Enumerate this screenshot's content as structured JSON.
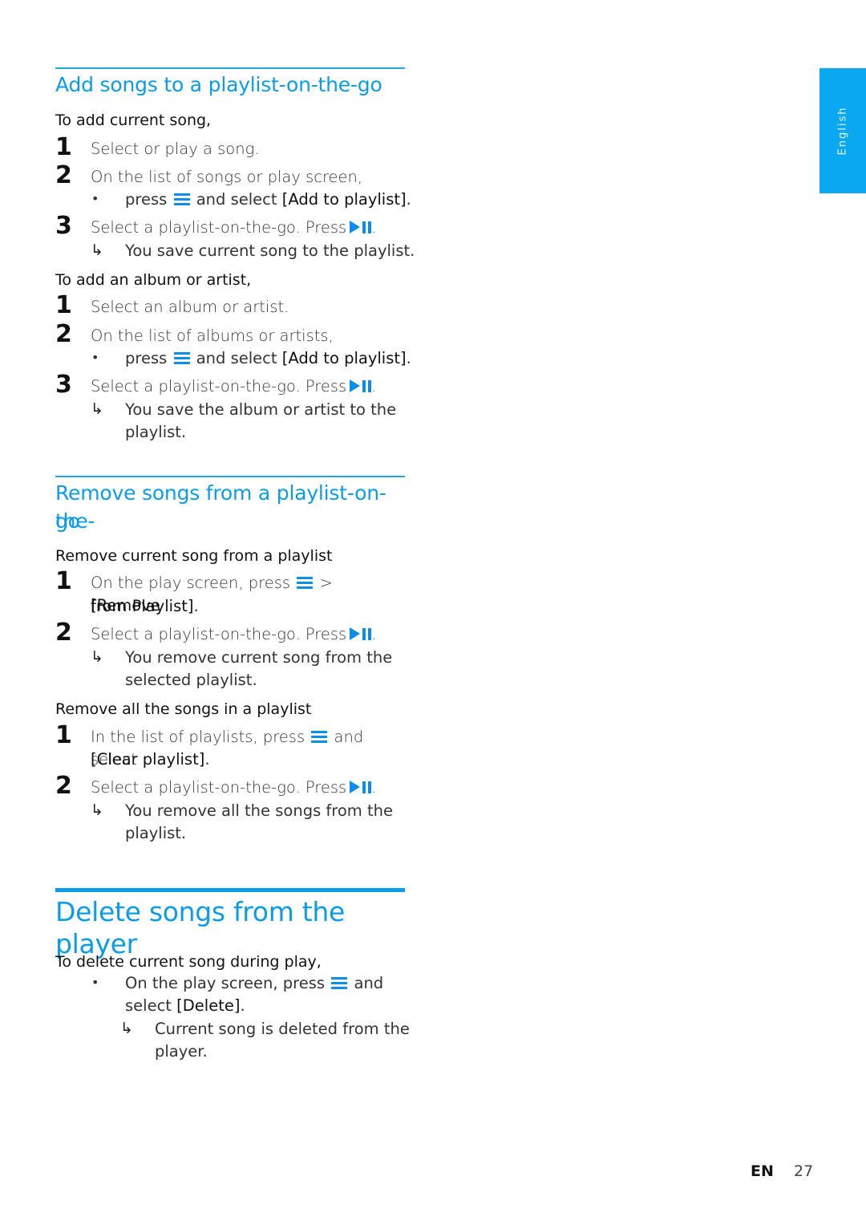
{
  "side_tab": {
    "label": "English",
    "color": "#0aa8ee"
  },
  "accent_color": "#0a9ce8",
  "section_add": {
    "title": "Add songs to a playlist-on-the-go",
    "current_song": {
      "heading": "To add current song,",
      "steps": [
        {
          "num": "1",
          "text": "Select or play a song."
        },
        {
          "num": "2",
          "text": "On the list of songs or play screen,",
          "bullet_pre": "press",
          "bullet_mid": "and select",
          "bullet_bold": "[Add to playlist]",
          "bullet_end": "."
        },
        {
          "num": "3",
          "text": "Select a playlist-on-the-go. Press",
          "text_end": ".",
          "result": "You save current song to the playlist."
        }
      ]
    },
    "album_artist": {
      "heading": "To add an album or artist,",
      "steps": [
        {
          "num": "1",
          "text": "Select an album or artist."
        },
        {
          "num": "2",
          "text": "On the list of albums or artists,",
          "bullet_pre": "press",
          "bullet_mid": "and select",
          "bullet_bold": "[Add to playlist]",
          "bullet_end": "."
        },
        {
          "num": "3",
          "text": "Select a playlist-on-the-go. Press",
          "text_end": ".",
          "result_line1": "You save the album or artist to the",
          "result_line2": "playlist."
        }
      ]
    }
  },
  "section_remove": {
    "title_line1": "Remove songs from a playlist-on-the-",
    "title_line2": "go",
    "current": {
      "heading": "Remove current song from a playlist",
      "steps": [
        {
          "num": "1",
          "text": "On the play screen, press",
          "sep": ">",
          "bold_line1": "[Remove",
          "bold_line2": "from Playlist]",
          "end": "."
        },
        {
          "num": "2",
          "text": "Select a playlist-on-the-go. Press",
          "text_end": ".",
          "result_line1": "You remove current song from the",
          "result_line2": "selected playlist."
        }
      ]
    },
    "all": {
      "heading": "Remove all the songs in a playlist",
      "steps": [
        {
          "num": "1",
          "text": "In the list of playlists, press",
          "text_mid": "and select",
          "bold": "[Clear playlist]",
          "end": "."
        },
        {
          "num": "2",
          "text": "Select a playlist-on-the-go. Press",
          "text_end": ".",
          "result_line1": "You remove all the songs from the",
          "result_line2": "playlist."
        }
      ]
    }
  },
  "section_delete": {
    "title": "Delete songs from the player",
    "heading": "To delete current song during play,",
    "bullet_pre": "On the play screen, press",
    "bullet_mid": "and",
    "bullet_line2_pre": "select",
    "bullet_bold": "[Delete]",
    "bullet_end": ".",
    "result_line1": "Current song is deleted from the",
    "result_line2": "player."
  },
  "footer": {
    "lang": "EN",
    "page": "27"
  },
  "glyphs": {
    "bullet": "•",
    "result_arrow": "↳"
  }
}
